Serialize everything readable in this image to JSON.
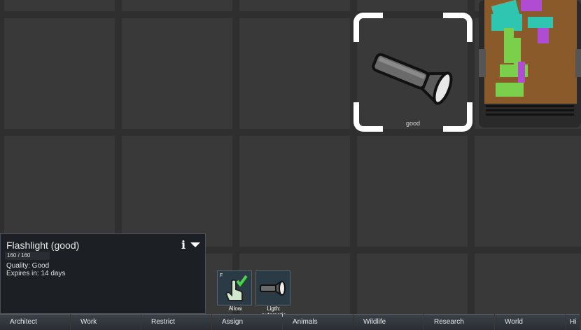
{
  "item_label": "good",
  "inspect": {
    "title": "Flashlight (good)",
    "hit_points": "160 / 160",
    "hit_points_fraction": 1.0,
    "quality": "Quality: Good",
    "expires": "Expires in: 14 days",
    "info_icon": "i"
  },
  "gizmos": [
    {
      "icon": "hand-allow-icon",
      "hotkey": "F",
      "label": "Allow"
    },
    {
      "icon": "flashlight-icon",
      "hotkey": "",
      "label": "Ligth:\nautomatic"
    }
  ],
  "main_tabs": [
    "Architect",
    "Work",
    "Restrict",
    "Assign",
    "Animals",
    "Wildlife",
    "Research",
    "World",
    "Hi"
  ],
  "colors": {
    "selection": "#ffffff",
    "panel_bg": "#1c1f24",
    "accent_check": "#49d449"
  }
}
